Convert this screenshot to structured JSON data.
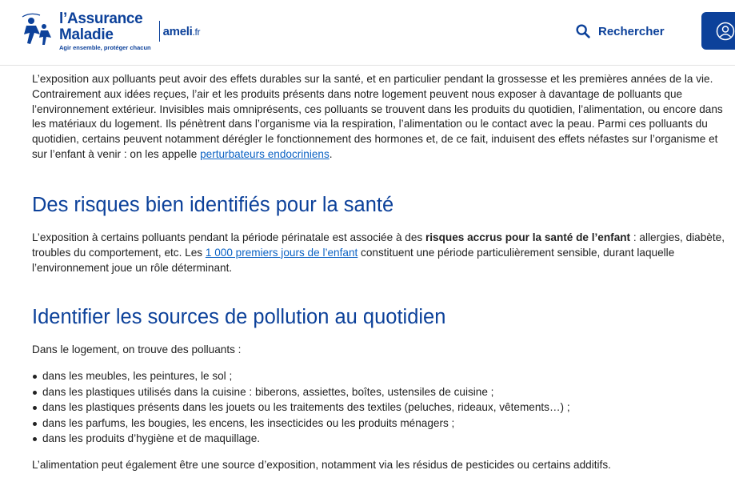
{
  "header": {
    "logo_line1": "l’Assurance",
    "logo_line2": "Maladie",
    "logo_tagline": "Agir ensemble, protéger chacun",
    "ameli": "ameli",
    "ameli_suffix": ".fr",
    "search_label": "Rechercher",
    "icons": {
      "search": "search-icon",
      "account": "user-account-icon"
    }
  },
  "colors": {
    "brand": "#0c419a",
    "link": "#0c63c4",
    "text": "#222222"
  },
  "article": {
    "intro": {
      "text": "L’exposition aux polluants peut avoir des effets durables sur la santé, et en particulier pendant la grossesse et les premières années de la vie. Contrairement aux idées reçues, l’air et les produits présents dans notre logement peuvent nous exposer à davantage de polluants que l’environnement extérieur. Invisibles mais omniprésents, ces polluants se trouvent dans les produits du quotidien, l’alimentation, ou encore dans les matériaux du logement. Ils pénètrent dans l’organisme via la respiration, l’alimentation ou le contact avec la peau. Parmi ces polluants du quotidien, certains peuvent notamment dérégler le fonctionnement des hormones et, de ce fait, induisent des effets néfastes sur l’organisme et sur l’enfant à venir : on les appelle ",
      "link": "perturbateurs endocriniens",
      "end": "."
    },
    "risks": {
      "heading": "Des risques bien identifiés pour la santé",
      "text_before": "L’exposition à certains polluants pendant la période périnatale est associée à des ",
      "bold": "risques accrus pour la santé de l’enfant",
      "text_middle": " : allergies, diabète, troubles du comportement, etc. Les ",
      "link": "1 000 premiers jours de l’enfant",
      "text_after": " constituent une période particulièrement sensible, durant laquelle l’environnement joue un rôle déterminant."
    },
    "sources": {
      "heading": "Identifier les sources de pollution au quotidien",
      "intro": "Dans le logement, on trouve des polluants :",
      "items": [
        "dans les meubles, les peintures, le sol ;",
        "dans les plastiques utilisés dans la cuisine : biberons, assiettes, boîtes, ustensiles de cuisine ;",
        "dans les plastiques présents dans les jouets ou les traitements des textiles (peluches, rideaux, vêtements…) ;",
        "dans les parfums, les bougies, les encens, les insecticides ou les produits ménagers ;",
        "dans les produits d’hygiène et de maquillage."
      ],
      "food": "L’alimentation peut également être une source d’exposition, notamment via les résidus de pesticides ou certains additifs."
    }
  }
}
